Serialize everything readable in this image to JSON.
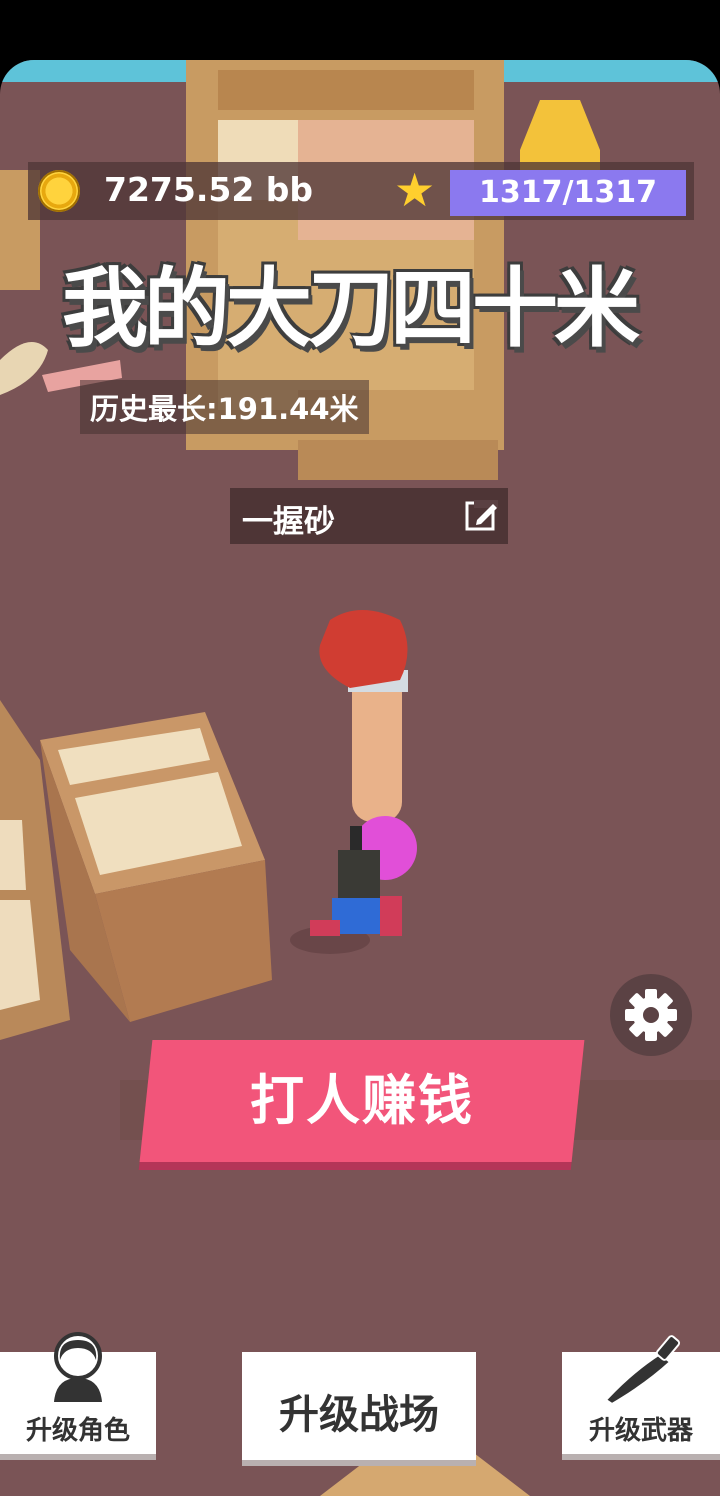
{
  "hud": {
    "coins": "7275.52 bb",
    "coin_icon": "coin-icon",
    "star_icon": "star-icon",
    "xp": "1317/1317",
    "xp_fraction": 1.0
  },
  "title": "我的大刀四十米",
  "record": "历史最长:191.44米",
  "player_name": "一握砂",
  "main_button": "打人赚钱",
  "bottom": {
    "left": "升级角色",
    "middle": "升级战场",
    "right": "升级武器"
  },
  "colors": {
    "accent_button": "#f2557a",
    "xp_bar": "#8b79ef",
    "floor": "#7a5456"
  }
}
